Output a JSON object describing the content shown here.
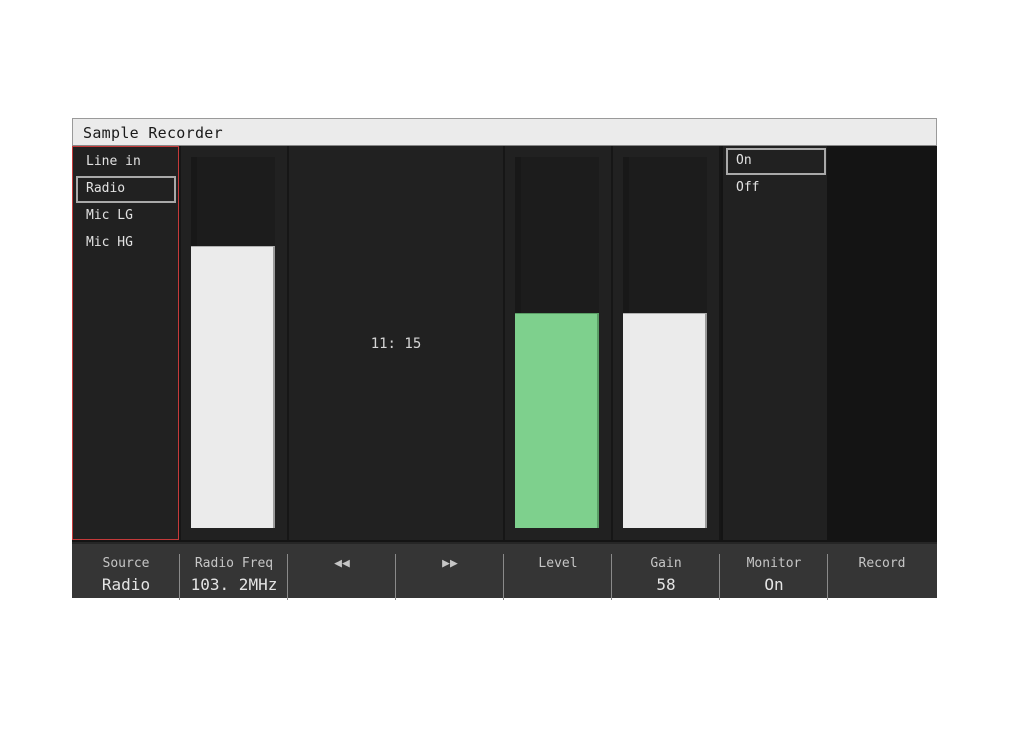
{
  "window": {
    "title": "Sample Recorder"
  },
  "source_list": {
    "items": [
      "Line in",
      "Radio",
      "Mic LG",
      "Mic HG"
    ],
    "selected": "Radio"
  },
  "meters": {
    "radio_freq_level": 0.76,
    "level": 0.58,
    "gain": 0.58,
    "level_color": "#7ed08d",
    "fill_color": "#ebebeb"
  },
  "time_display": "11: 15",
  "monitor_list": {
    "items": [
      "On",
      "Off"
    ],
    "selected": "On"
  },
  "footer": {
    "buttons": [
      {
        "label": "Source",
        "value": "Radio"
      },
      {
        "label": "Radio Freq",
        "value": "103. 2MHz"
      },
      {
        "label": "◀◀",
        "value": ""
      },
      {
        "label": "▶▶",
        "value": ""
      },
      {
        "label": "Level",
        "value": ""
      },
      {
        "label": "Gain",
        "value": "58"
      },
      {
        "label": "Monitor",
        "value": "On"
      },
      {
        "label": "Record",
        "value": ""
      }
    ]
  },
  "colors": {
    "source_list_border": "#c43a3a",
    "panel_bg": "#212121",
    "footer_bg": "#353535"
  }
}
